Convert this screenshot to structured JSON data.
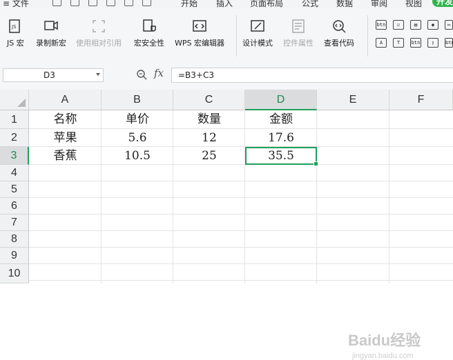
{
  "menu": {
    "file": "文件",
    "tabs": [
      "开始",
      "插入",
      "页面布局",
      "公式",
      "数据",
      "审阅",
      "视图"
    ],
    "dev_badge": "开发"
  },
  "ribbon": {
    "buttons": [
      {
        "label": "JS 宏",
        "icon": "js-macro-icon",
        "enabled": true
      },
      {
        "label": "录制新宏",
        "icon": "record-macro-icon",
        "enabled": true
      },
      {
        "label": "使用相对引用",
        "icon": "relative-reference-icon",
        "enabled": false
      },
      {
        "label": "宏安全性",
        "icon": "macro-security-icon",
        "enabled": true
      },
      {
        "label": "WPS 宏编辑器",
        "icon": "macro-editor-icon",
        "enabled": true
      },
      {
        "label": "设计模式",
        "icon": "design-mode-icon",
        "enabled": true
      },
      {
        "label": "控件属性",
        "icon": "control-properties-icon",
        "enabled": false
      },
      {
        "label": "查看代码",
        "icon": "view-code-icon",
        "enabled": true
      }
    ],
    "small_controls": [
      "btn",
      "☑",
      "▤",
      "◉",
      "▭",
      "btn",
      "A",
      "T",
      "btn",
      "▯"
    ]
  },
  "formula_bar": {
    "name_box": "D3",
    "fx": "fx",
    "formula": "=B3+C3"
  },
  "sheet": {
    "columns": [
      "A",
      "B",
      "C",
      "D",
      "E",
      "F"
    ],
    "rows": [
      "1",
      "2",
      "3",
      "4",
      "5",
      "6",
      "7",
      "8",
      "9",
      "10"
    ],
    "selected_cell": "D3",
    "cells": [
      [
        "名称",
        "单价",
        "数量",
        "金额"
      ],
      [
        "苹果",
        "5.6",
        "12",
        "17.6"
      ],
      [
        "香蕉",
        "10.5",
        "25",
        "35.5"
      ]
    ]
  },
  "watermark": {
    "brand": "Baidu经验",
    "url": "jingyan.baidu.com"
  },
  "colors": {
    "accent_green": "#1f9e5a",
    "ribbon_bg": "#f5f6f7",
    "header_bg": "#f0f1f2"
  }
}
